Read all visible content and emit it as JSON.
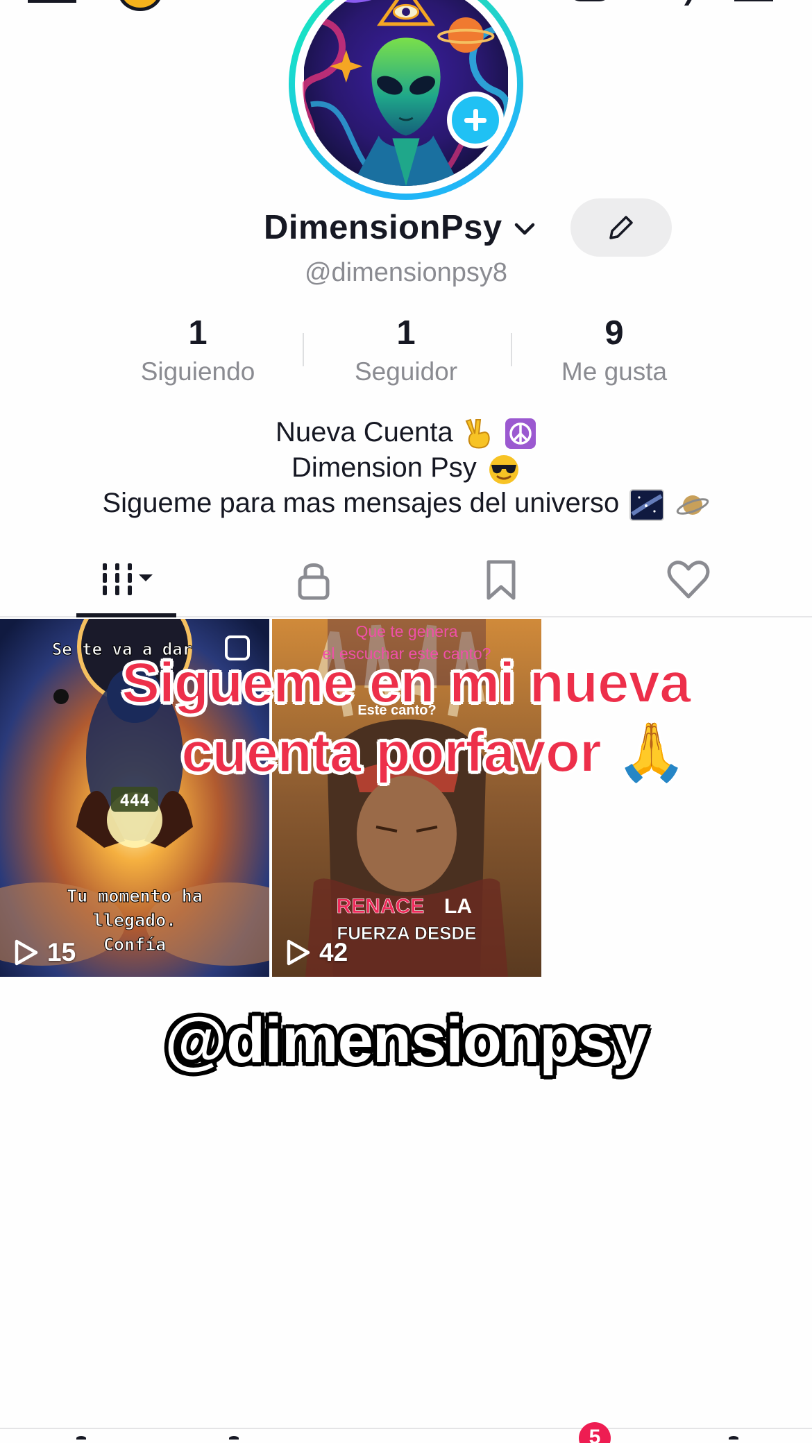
{
  "profile": {
    "display_name": "DimensionPsy",
    "handle": "@dimensionpsy8"
  },
  "stats": {
    "following_count": "1",
    "following_label": "Siguiendo",
    "followers_count": "1",
    "followers_label": "Seguidor",
    "likes_count": "9",
    "likes_label": "Me gusta"
  },
  "bio": {
    "line1": "Nueva Cuenta",
    "line2": "Dimension Psy",
    "line3": "Sigueme para mas mensajes del universo"
  },
  "tabs": [
    {
      "name": "videos",
      "icon": "grid-icon",
      "active": true
    },
    {
      "name": "private",
      "icon": "lock-icon"
    },
    {
      "name": "saved",
      "icon": "bookmark-icon"
    },
    {
      "name": "liked",
      "icon": "heart-icon"
    }
  ],
  "videos": [
    {
      "views": "15",
      "top_text": "Se te va a dar",
      "center_text": "444",
      "bottom_text_1": "Tu momento ha",
      "bottom_text_2": "llegado.",
      "bottom_text_3": "Confía"
    },
    {
      "views": "42",
      "top_text_1": "Que te genera",
      "top_text_2": "el escuchar este canto?",
      "mid_text": "Este canto?",
      "bottom_text_1a": "RENACE",
      "bottom_text_1b": "LA",
      "bottom_text_2": "FUERZA DESDE"
    }
  ],
  "overlay": {
    "line1": "Sigueme en mi nueva",
    "line2": "cuenta porfavor 🙏",
    "handle_caption": "@dimensionpsy"
  },
  "bottom_nav": {
    "inbox_badge": "5"
  },
  "colors": {
    "accent_red": "#ed2f4a",
    "avatar_plus": "#20c1f4",
    "badge": "#ee1d52"
  }
}
